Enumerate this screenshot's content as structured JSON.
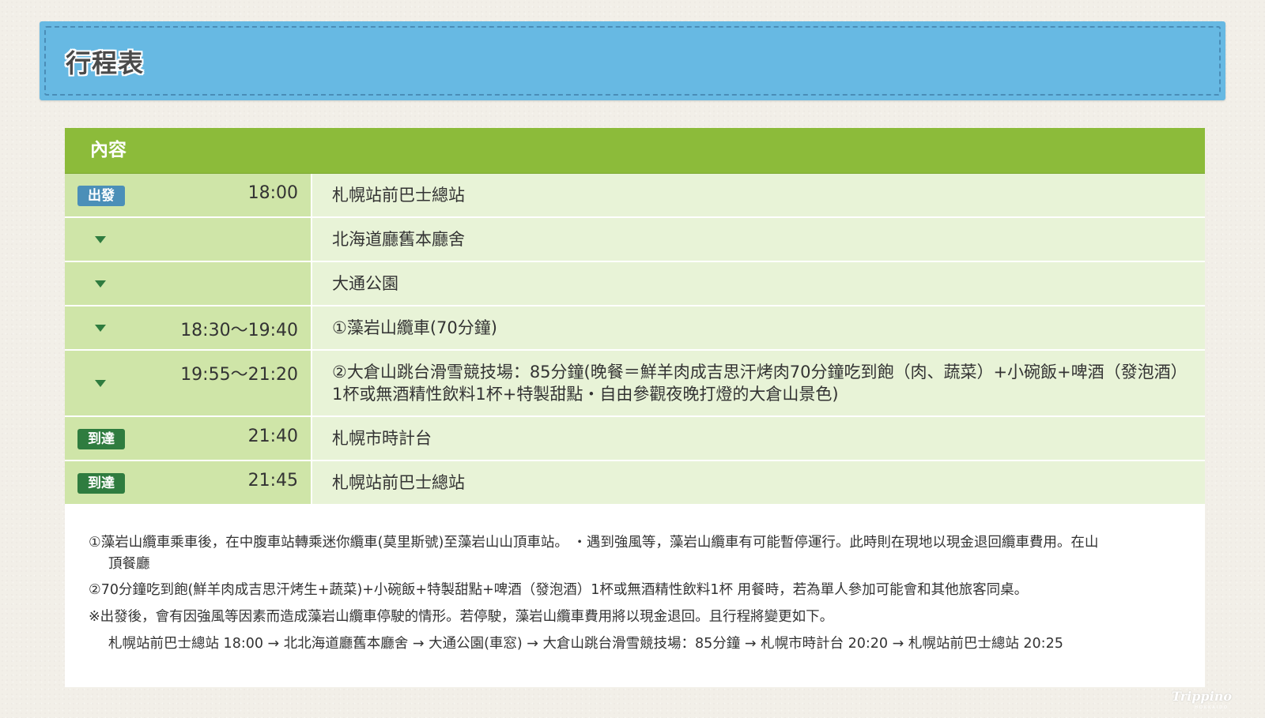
{
  "banner": {
    "title": "行程表"
  },
  "table": {
    "header": "內容",
    "rows": [
      {
        "badge": "出發",
        "time": "18:00",
        "content": "札幌站前巴士總站"
      },
      {
        "time": "",
        "content": "北海道廳舊本廳舍"
      },
      {
        "time": "",
        "content": "大通公園"
      },
      {
        "time": "18:30～19:40",
        "content": "①藻岩山纜車(70分鐘)"
      },
      {
        "time": "19:55～21:20",
        "content": "②大倉山跳台滑雪競技場：85分鐘(晚餐＝鮮羊肉成吉思汗烤肉70分鐘吃到飽（肉、蔬菜）+小碗飯+啤酒（發泡酒）1杯或無酒精性飲料1杯+特製甜點・自由參觀夜晚打燈的大倉山景色)"
      },
      {
        "badge": "到達",
        "time": "21:40",
        "content": "札幌市時計台"
      },
      {
        "badge": "到達",
        "time": "21:45",
        "content": "札幌站前巴士總站"
      }
    ]
  },
  "notes": {
    "line1": "①藻岩山纜車乘車後，在中腹車站轉乘迷你纜車(莫里斯號)至藻岩山山頂車站。 ・遇到強風等，藻岩山纜車有可能暫停運行。此時則在現地以現金退回纜車費用。在山",
    "line1_cont": "頂餐廳",
    "line2": "②70分鐘吃到飽(鮮羊肉成吉思汗烤生+蔬菜)+小碗飯+特製甜點+啤酒（發泡酒）1杯或無酒精性飲料1杯 用餐時，若為單人參加可能會和其他旅客同桌。",
    "line3": "※出發後，會有因強風等因素而造成藻岩山纜車停駛的情形。若停駛，藻岩山纜車費用將以現金退回。且行程將變更如下。",
    "line4": "札幌站前巴士總站 18:00 → 北北海道廳舊本廳舍 → 大通公園(車窓) → 大倉山跳台滑雪競技場：85分鐘 → 札幌市時計台 20:20 → 札幌站前巴士總站 20:25"
  },
  "watermark": {
    "text": "Trippino",
    "sub": "HOKKAIDO"
  }
}
